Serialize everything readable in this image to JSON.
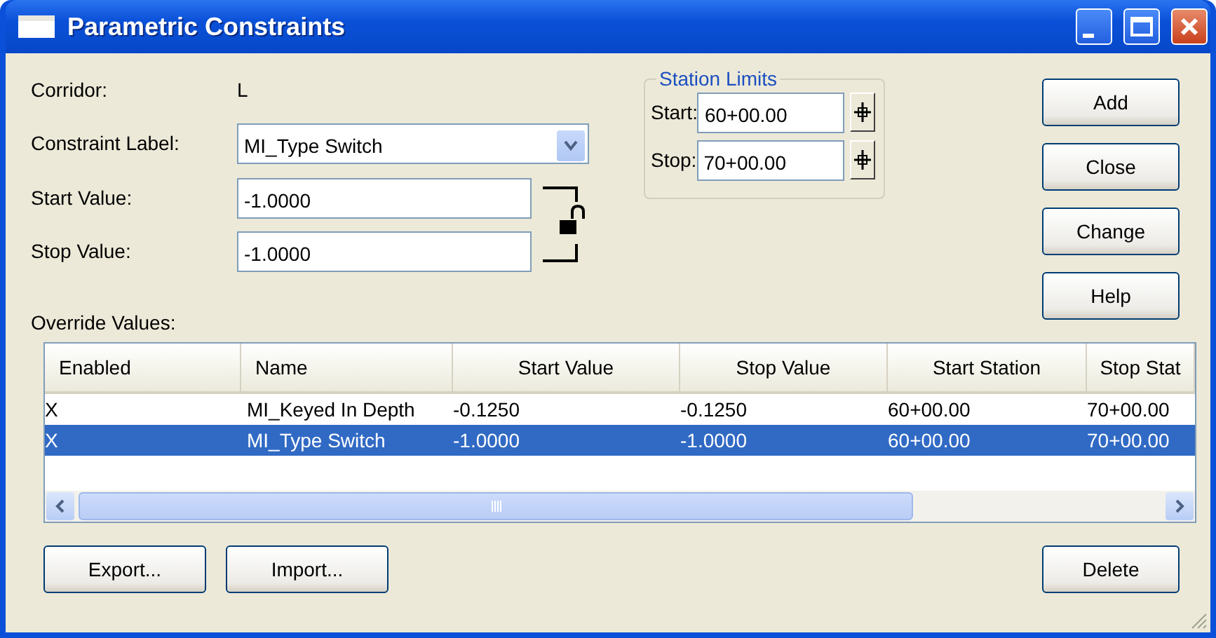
{
  "window": {
    "title": "Parametric Constraints"
  },
  "corridor": {
    "label": "Corridor:",
    "value": "L"
  },
  "constraint_label": {
    "label": "Constraint Label:",
    "value": "MI_Type Switch"
  },
  "start_value": {
    "label": "Start Value:",
    "value": "-1.0000"
  },
  "stop_value": {
    "label": "Stop Value:",
    "value": "-1.0000"
  },
  "station_limits": {
    "title": "Station Limits",
    "start": {
      "label": "Start:",
      "value": "60+00.00"
    },
    "stop": {
      "label": "Stop:",
      "value": "70+00.00"
    }
  },
  "side_buttons": [
    "Add",
    "Close",
    "Change",
    "Help"
  ],
  "override_values": {
    "label": "Override Values:",
    "columns": [
      "Enabled",
      "Name",
      "Start Value",
      "Stop Value",
      "Start Station",
      "Stop Stat"
    ],
    "rows": [
      {
        "cells": [
          "X",
          "MI_Keyed In Depth",
          "-0.1250",
          "-0.1250",
          "60+00.00",
          "70+00.00"
        ],
        "selected": false
      },
      {
        "cells": [
          "X",
          "MI_Type Switch",
          "-1.0000",
          "-1.0000",
          "60+00.00",
          "70+00.00"
        ],
        "selected": true
      }
    ]
  },
  "bottom_buttons": {
    "left": [
      "Export...",
      "Import..."
    ],
    "right": [
      "Delete"
    ]
  }
}
